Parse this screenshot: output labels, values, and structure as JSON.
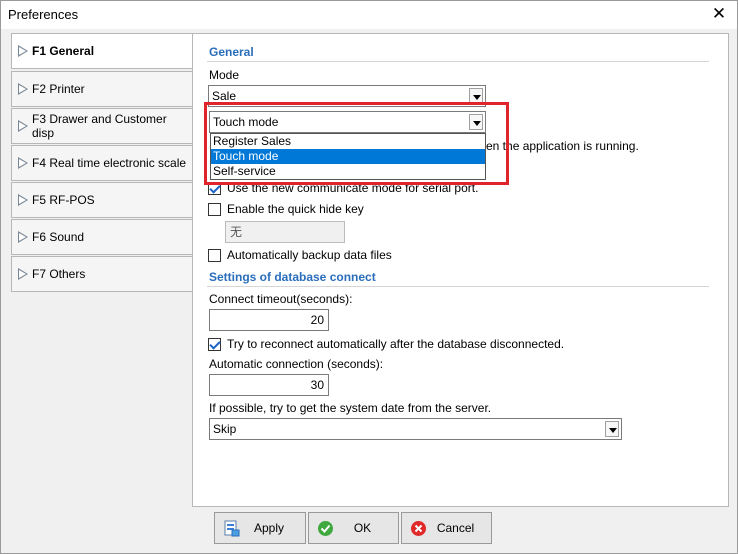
{
  "window": {
    "title": "Preferences"
  },
  "nav": {
    "items": [
      {
        "label": "F1 General",
        "active": true
      },
      {
        "label": "F2 Printer"
      },
      {
        "label": "F3 Drawer and Customer disp"
      },
      {
        "label": "F4 Real time electronic scale"
      },
      {
        "label": "F5 RF-POS"
      },
      {
        "label": "F6 Sound"
      },
      {
        "label": "F7 Others"
      }
    ]
  },
  "general": {
    "section_title": "General",
    "mode_label": "Mode",
    "mode_value": "Sale",
    "ui_mode_value": "Touch mode",
    "ui_mode_options": [
      "Register Sales",
      "Touch mode",
      "Self-service"
    ],
    "partial_text": "en the application is running.",
    "serial_check_label": "Use the new communicate mode for serial port.",
    "quick_hide_label": "Enable the quick hide key",
    "quick_hide_value": "无",
    "backup_label": "Automatically backup data files"
  },
  "database": {
    "section_title": "Settings of database connect",
    "timeout_label": "Connect timeout(seconds):",
    "timeout_value": "20",
    "reconnect_label": "Try to reconnect automatically after the database disconnected.",
    "auto_conn_label": "Automatic connection (seconds):",
    "auto_conn_value": "30",
    "sysdate_label": "If possible, try to get the system date from the server.",
    "sysdate_value": "Skip"
  },
  "buttons": {
    "apply": "Apply",
    "ok": "OK",
    "cancel": "Cancel"
  },
  "colors": {
    "accent": "#2a6ebb",
    "highlight": "#e0242c",
    "selection": "#0078d7"
  }
}
